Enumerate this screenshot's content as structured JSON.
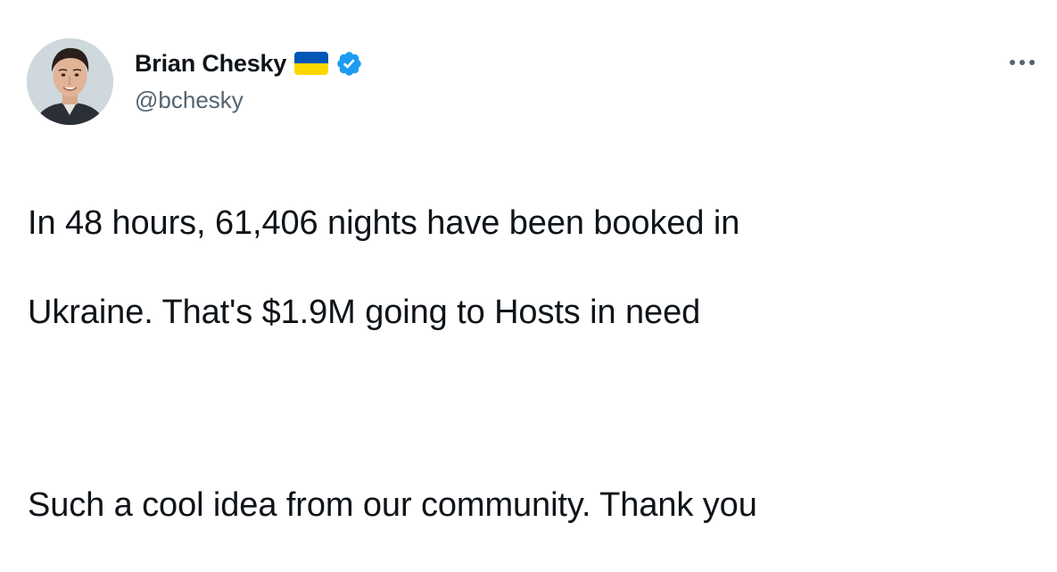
{
  "tweet": {
    "author": {
      "display_name": "Brian Chesky",
      "handle": "@bchesky",
      "flag_icon": "ukraine-flag-icon",
      "verified_icon": "verified-badge-icon",
      "avatar_icon": "avatar-photo"
    },
    "more_icon": "more-options-icon",
    "text_lines": [
      "In 48 hours, 61,406 nights have been booked in",
      "Ukraine. That's $1.9M going to Hosts in need",
      "Such a cool idea from our community. Thank you"
    ]
  },
  "colors": {
    "text": "#0f1419",
    "secondary_text": "#536471",
    "verified_blue": "#1d9bf0",
    "flag_blue": "#0057b7",
    "flag_yellow": "#ffd700"
  }
}
